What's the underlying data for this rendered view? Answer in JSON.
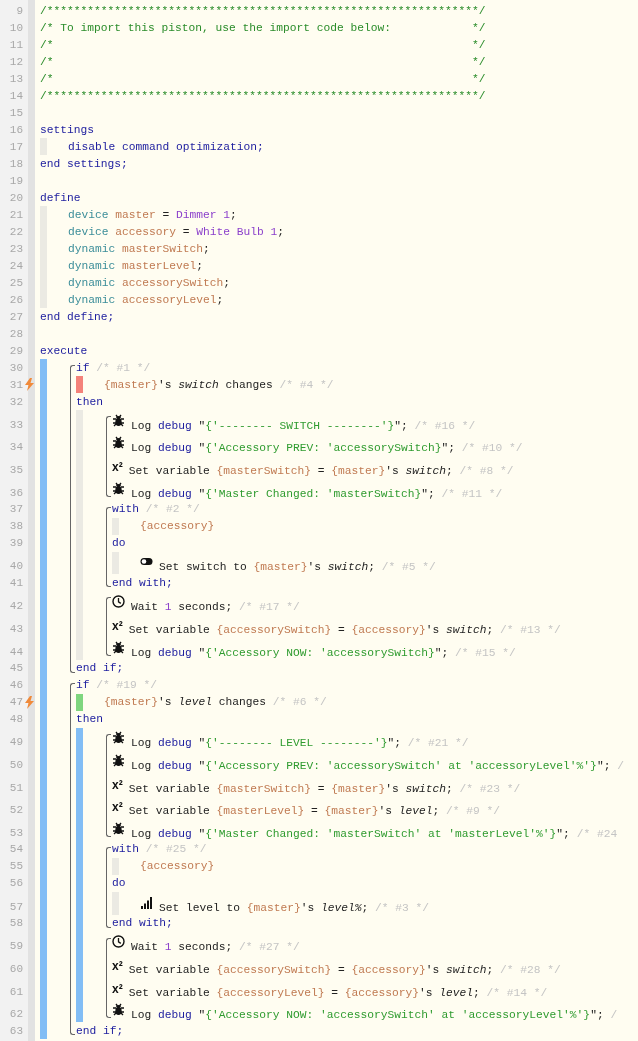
{
  "code": [
    {
      "kind": "line",
      "number": "9",
      "trigger": false,
      "tokens": [
        {
          "kind": "comment",
          "text": "/****************************************************************/"
        }
      ]
    },
    {
      "kind": "line",
      "number": "10",
      "trigger": false,
      "tokens": [
        {
          "kind": "comment",
          "text": "/* To import this piston, use the import code below:            */"
        }
      ]
    },
    {
      "kind": "line",
      "number": "11",
      "trigger": false,
      "tokens": [
        {
          "kind": "comment",
          "text": "/*                                                              */"
        }
      ]
    },
    {
      "kind": "line",
      "number": "12",
      "trigger": false,
      "tokens": [
        {
          "kind": "comment",
          "text": "/*                                                              */"
        }
      ]
    },
    {
      "kind": "line",
      "number": "13",
      "trigger": false,
      "tokens": [
        {
          "kind": "comment",
          "text": "/*                                                              */"
        }
      ]
    },
    {
      "kind": "line",
      "number": "14",
      "trigger": false,
      "tokens": [
        {
          "kind": "comment",
          "text": "/****************************************************************/"
        }
      ]
    },
    {
      "kind": "line",
      "number": "15",
      "trigger": false
    },
    {
      "kind": "line",
      "number": "16",
      "trigger": false,
      "tokens": [
        {
          "kind": "keyword",
          "text": "settings"
        }
      ]
    },
    {
      "kind": "block",
      "color": "#ebeae3",
      "items": [
        {
          "kind": "line",
          "number": "17",
          "trigger": false,
          "tokens": [
            {
              "kind": "keyword",
              "text": "disable command optimization;"
            }
          ]
        }
      ]
    },
    {
      "kind": "line",
      "number": "18",
      "trigger": false,
      "tokens": [
        {
          "kind": "keyword",
          "text": "end settings;"
        }
      ]
    },
    {
      "kind": "line",
      "number": "19",
      "trigger": false
    },
    {
      "kind": "line",
      "number": "20",
      "trigger": false,
      "tokens": [
        {
          "kind": "keyword",
          "text": "define"
        }
      ]
    },
    {
      "kind": "block",
      "color": "#ebeae3",
      "items": [
        {
          "kind": "line",
          "number": "21",
          "trigger": false,
          "tokens": [
            {
              "kind": "type",
              "text": "device "
            },
            {
              "kind": "var",
              "text": "master"
            },
            {
              "kind": "plain",
              "text": " = "
            },
            {
              "kind": "value",
              "text": "Dimmer 1"
            },
            {
              "kind": "plain",
              "text": ";"
            }
          ]
        },
        {
          "kind": "line",
          "number": "22",
          "trigger": false,
          "tokens": [
            {
              "kind": "type",
              "text": "device "
            },
            {
              "kind": "var",
              "text": "accessory"
            },
            {
              "kind": "plain",
              "text": " = "
            },
            {
              "kind": "value",
              "text": "White Bulb 1"
            },
            {
              "kind": "plain",
              "text": ";"
            }
          ]
        },
        {
          "kind": "line",
          "number": "23",
          "trigger": false,
          "tokens": [
            {
              "kind": "type",
              "text": "dynamic "
            },
            {
              "kind": "var",
              "text": "masterSwitch"
            },
            {
              "kind": "plain",
              "text": ";"
            }
          ]
        },
        {
          "kind": "line",
          "number": "24",
          "trigger": false,
          "tokens": [
            {
              "kind": "type",
              "text": "dynamic "
            },
            {
              "kind": "var",
              "text": "masterLevel"
            },
            {
              "kind": "plain",
              "text": ";"
            }
          ]
        },
        {
          "kind": "line",
          "number": "25",
          "trigger": false,
          "tokens": [
            {
              "kind": "type",
              "text": "dynamic "
            },
            {
              "kind": "var",
              "text": "accessorySwitch"
            },
            {
              "kind": "plain",
              "text": ";"
            }
          ]
        },
        {
          "kind": "line",
          "number": "26",
          "trigger": false,
          "tokens": [
            {
              "kind": "type",
              "text": "dynamic "
            },
            {
              "kind": "var",
              "text": "accessoryLevel"
            },
            {
              "kind": "plain",
              "text": ";"
            }
          ]
        }
      ]
    },
    {
      "kind": "line",
      "number": "27",
      "trigger": false,
      "tokens": [
        {
          "kind": "keyword",
          "text": "end define;"
        }
      ]
    },
    {
      "kind": "line",
      "number": "28",
      "trigger": false
    },
    {
      "kind": "line",
      "number": "29",
      "trigger": false,
      "tokens": [
        {
          "kind": "keyword",
          "text": "execute"
        }
      ]
    },
    {
      "kind": "block",
      "color": "#82bdf5",
      "items": [
        {
          "kind": "bracket",
          "items": [
            {
              "kind": "line",
              "number": "30",
              "trigger": false,
              "tokens": [
                {
                  "kind": "keyword",
                  "text": "if "
                },
                {
                  "kind": "note",
                  "text": "/* #1 */"
                }
              ]
            },
            {
              "kind": "block",
              "color": "#f4827a",
              "items": [
                {
                  "kind": "line",
                  "number": "31",
                  "trigger": true,
                  "tokens": [
                    {
                      "kind": "var",
                      "text": "{master}"
                    },
                    {
                      "kind": "plain",
                      "text": "'s "
                    },
                    {
                      "kind": "italic",
                      "text": "switch"
                    },
                    {
                      "kind": "plain",
                      "text": " changes "
                    },
                    {
                      "kind": "note",
                      "text": "/* #4 */"
                    }
                  ]
                }
              ]
            },
            {
              "kind": "line",
              "number": "32",
              "trigger": false,
              "tokens": [
                {
                  "kind": "keyword",
                  "text": "then"
                }
              ]
            },
            {
              "kind": "block",
              "color": "#ebeae3",
              "items": [
                {
                  "kind": "bracket",
                  "items": [
                    {
                      "kind": "log",
                      "number": "33",
                      "trigger": false,
                      "tokens": [
                        {
                          "kind": "plain",
                          "text": "Log "
                        },
                        {
                          "kind": "keyword",
                          "text": "debug "
                        },
                        {
                          "kind": "plain",
                          "text": "\""
                        },
                        {
                          "kind": "string",
                          "text": "{'-------- SWITCH --------'}"
                        },
                        {
                          "kind": "plain",
                          "text": "\"; "
                        },
                        {
                          "kind": "note",
                          "text": "/* #16 */"
                        }
                      ]
                    },
                    {
                      "kind": "log",
                      "number": "34",
                      "trigger": false,
                      "tokens": [
                        {
                          "kind": "plain",
                          "text": "Log "
                        },
                        {
                          "kind": "keyword",
                          "text": "debug "
                        },
                        {
                          "kind": "plain",
                          "text": "\""
                        },
                        {
                          "kind": "string",
                          "text": "{'Accessory PREV: 'accessorySwitch}"
                        },
                        {
                          "kind": "plain",
                          "text": "\"; "
                        },
                        {
                          "kind": "note",
                          "text": "/* #10 */"
                        }
                      ]
                    },
                    {
                      "kind": "set",
                      "number": "35",
                      "trigger": false,
                      "glyph": "x²",
                      "tokens": [
                        {
                          "kind": "plain",
                          "text": "Set variable "
                        },
                        {
                          "kind": "var",
                          "text": "{masterSwitch}"
                        },
                        {
                          "kind": "plain",
                          "text": " = "
                        },
                        {
                          "kind": "var",
                          "text": "{master}"
                        },
                        {
                          "kind": "plain",
                          "text": "'s "
                        },
                        {
                          "kind": "italic",
                          "text": "switch"
                        },
                        {
                          "kind": "plain",
                          "text": "; "
                        },
                        {
                          "kind": "note",
                          "text": "/* #8 */"
                        }
                      ]
                    },
                    {
                      "kind": "log",
                      "number": "36",
                      "trigger": false,
                      "tokens": [
                        {
                          "kind": "plain",
                          "text": "Log "
                        },
                        {
                          "kind": "keyword",
                          "text": "debug "
                        },
                        {
                          "kind": "plain",
                          "text": "\""
                        },
                        {
                          "kind": "string",
                          "text": "{'Master Changed: 'masterSwitch}"
                        },
                        {
                          "kind": "plain",
                          "text": "\"; "
                        },
                        {
                          "kind": "note",
                          "text": "/* #11 */"
                        }
                      ]
                    }
                  ]
                },
                {
                  "kind": "bracket",
                  "items": [
                    {
                      "kind": "line",
                      "number": "37",
                      "trigger": false,
                      "tokens": [
                        {
                          "kind": "keyword",
                          "text": "with "
                        },
                        {
                          "kind": "note",
                          "text": "/* #2 */"
                        }
                      ]
                    },
                    {
                      "kind": "block",
                      "color": "#ebeae3",
                      "items": [
                        {
                          "kind": "line",
                          "number": "38",
                          "trigger": false,
                          "tokens": [
                            {
                              "kind": "var",
                              "text": "{accessory}"
                            }
                          ]
                        }
                      ]
                    },
                    {
                      "kind": "line",
                      "number": "39",
                      "trigger": false,
                      "tokens": [
                        {
                          "kind": "keyword",
                          "text": "do"
                        }
                      ]
                    },
                    {
                      "kind": "block",
                      "color": "#ebeae3",
                      "items": [
                        {
                          "kind": "switch",
                          "number": "40",
                          "trigger": false,
                          "tokens": [
                            {
                              "kind": "plain",
                              "text": "Set switch to "
                            },
                            {
                              "kind": "var",
                              "text": "{master}"
                            },
                            {
                              "kind": "plain",
                              "text": "'s "
                            },
                            {
                              "kind": "italic",
                              "text": "switch"
                            },
                            {
                              "kind": "plain",
                              "text": "; "
                            },
                            {
                              "kind": "note",
                              "text": "/* #5 */"
                            }
                          ]
                        }
                      ]
                    },
                    {
                      "kind": "line",
                      "number": "41",
                      "trigger": false,
                      "tokens": [
                        {
                          "kind": "keyword",
                          "text": "end with;"
                        }
                      ]
                    }
                  ]
                },
                {
                  "kind": "bracket",
                  "items": [
                    {
                      "kind": "wait",
                      "number": "42",
                      "trigger": false,
                      "tokens": [
                        {
                          "kind": "plain",
                          "text": "Wait "
                        },
                        {
                          "kind": "value",
                          "text": "1"
                        },
                        {
                          "kind": "plain",
                          "text": " seconds; "
                        },
                        {
                          "kind": "note",
                          "text": "/* #17 */"
                        }
                      ]
                    },
                    {
                      "kind": "set",
                      "number": "43",
                      "trigger": false,
                      "glyph": "x²",
                      "tokens": [
                        {
                          "kind": "plain",
                          "text": "Set variable "
                        },
                        {
                          "kind": "var",
                          "text": "{accessorySwitch}"
                        },
                        {
                          "kind": "plain",
                          "text": " = "
                        },
                        {
                          "kind": "var",
                          "text": "{accessory}"
                        },
                        {
                          "kind": "plain",
                          "text": "'s "
                        },
                        {
                          "kind": "italic",
                          "text": "switch"
                        },
                        {
                          "kind": "plain",
                          "text": "; "
                        },
                        {
                          "kind": "note",
                          "text": "/* #13 */"
                        }
                      ]
                    },
                    {
                      "kind": "log",
                      "number": "44",
                      "trigger": false,
                      "tokens": [
                        {
                          "kind": "plain",
                          "text": "Log "
                        },
                        {
                          "kind": "keyword",
                          "text": "debug "
                        },
                        {
                          "kind": "plain",
                          "text": "\""
                        },
                        {
                          "kind": "string",
                          "text": "{'Accessory NOW: 'accessorySwitch}"
                        },
                        {
                          "kind": "plain",
                          "text": "\"; "
                        },
                        {
                          "kind": "note",
                          "text": "/* #15 */"
                        }
                      ]
                    }
                  ]
                }
              ]
            },
            {
              "kind": "line",
              "number": "45",
              "trigger": false,
              "tokens": [
                {
                  "kind": "keyword",
                  "text": "end if;"
                }
              ]
            }
          ]
        },
        {
          "kind": "bracket",
          "items": [
            {
              "kind": "line",
              "number": "46",
              "trigger": false,
              "tokens": [
                {
                  "kind": "keyword",
                  "text": "if "
                },
                {
                  "kind": "note",
                  "text": "/* #19 */"
                }
              ]
            },
            {
              "kind": "block",
              "color": "#7fd67f",
              "items": [
                {
                  "kind": "line",
                  "number": "47",
                  "trigger": true,
                  "tokens": [
                    {
                      "kind": "var",
                      "text": "{master}"
                    },
                    {
                      "kind": "plain",
                      "text": "'s "
                    },
                    {
                      "kind": "italic",
                      "text": "level"
                    },
                    {
                      "kind": "plain",
                      "text": " changes "
                    },
                    {
                      "kind": "note",
                      "text": "/* #6 */"
                    }
                  ]
                }
              ]
            },
            {
              "kind": "line",
              "number": "48",
              "trigger": false,
              "tokens": [
                {
                  "kind": "keyword",
                  "text": "then"
                }
              ]
            },
            {
              "kind": "block",
              "color": "#82bdf5",
              "items": [
                {
                  "kind": "bracket",
                  "items": [
                    {
                      "kind": "log",
                      "number": "49",
                      "trigger": false,
                      "tokens": [
                        {
                          "kind": "plain",
                          "text": "Log "
                        },
                        {
                          "kind": "keyword",
                          "text": "debug "
                        },
                        {
                          "kind": "plain",
                          "text": "\""
                        },
                        {
                          "kind": "string",
                          "text": "{'-------- LEVEL --------'}"
                        },
                        {
                          "kind": "plain",
                          "text": "\"; "
                        },
                        {
                          "kind": "note",
                          "text": "/* #21 */"
                        }
                      ]
                    },
                    {
                      "kind": "log",
                      "number": "50",
                      "trigger": false,
                      "tokens": [
                        {
                          "kind": "plain",
                          "text": "Log "
                        },
                        {
                          "kind": "keyword",
                          "text": "debug "
                        },
                        {
                          "kind": "plain",
                          "text": "\""
                        },
                        {
                          "kind": "string",
                          "text": "{'Accessory PREV: 'accessorySwitch' at 'accessoryLevel'%'}"
                        },
                        {
                          "kind": "plain",
                          "text": "\"; "
                        },
                        {
                          "kind": "note",
                          "text": "/"
                        }
                      ]
                    },
                    {
                      "kind": "set",
                      "number": "51",
                      "trigger": false,
                      "glyph": "x²",
                      "tokens": [
                        {
                          "kind": "plain",
                          "text": "Set variable "
                        },
                        {
                          "kind": "var",
                          "text": "{masterSwitch}"
                        },
                        {
                          "kind": "plain",
                          "text": " = "
                        },
                        {
                          "kind": "var",
                          "text": "{master}"
                        },
                        {
                          "kind": "plain",
                          "text": "'s "
                        },
                        {
                          "kind": "italic",
                          "text": "switch"
                        },
                        {
                          "kind": "plain",
                          "text": "; "
                        },
                        {
                          "kind": "note",
                          "text": "/* #23 */"
                        }
                      ]
                    },
                    {
                      "kind": "set",
                      "number": "52",
                      "trigger": false,
                      "glyph": "x²",
                      "tokens": [
                        {
                          "kind": "plain",
                          "text": "Set variable "
                        },
                        {
                          "kind": "var",
                          "text": "{masterLevel}"
                        },
                        {
                          "kind": "plain",
                          "text": " = "
                        },
                        {
                          "kind": "var",
                          "text": "{master}"
                        },
                        {
                          "kind": "plain",
                          "text": "'s "
                        },
                        {
                          "kind": "italic",
                          "text": "level"
                        },
                        {
                          "kind": "plain",
                          "text": "; "
                        },
                        {
                          "kind": "note",
                          "text": "/* #9 */"
                        }
                      ]
                    },
                    {
                      "kind": "log",
                      "number": "53",
                      "trigger": false,
                      "tokens": [
                        {
                          "kind": "plain",
                          "text": "Log "
                        },
                        {
                          "kind": "keyword",
                          "text": "debug "
                        },
                        {
                          "kind": "plain",
                          "text": "\""
                        },
                        {
                          "kind": "string",
                          "text": "{'Master Changed: 'masterSwitch' at 'masterLevel'%'}"
                        },
                        {
                          "kind": "plain",
                          "text": "\"; "
                        },
                        {
                          "kind": "note",
                          "text": "/* #24"
                        }
                      ]
                    }
                  ]
                },
                {
                  "kind": "bracket",
                  "items": [
                    {
                      "kind": "line",
                      "number": "54",
                      "trigger": false,
                      "tokens": [
                        {
                          "kind": "keyword",
                          "text": "with "
                        },
                        {
                          "kind": "note",
                          "text": "/* #25 */"
                        }
                      ]
                    },
                    {
                      "kind": "block",
                      "color": "#ebeae3",
                      "items": [
                        {
                          "kind": "line",
                          "number": "55",
                          "trigger": false,
                          "tokens": [
                            {
                              "kind": "var",
                              "text": "{accessory}"
                            }
                          ]
                        }
                      ]
                    },
                    {
                      "kind": "line",
                      "number": "56",
                      "trigger": false,
                      "tokens": [
                        {
                          "kind": "keyword",
                          "text": "do"
                        }
                      ]
                    },
                    {
                      "kind": "block",
                      "color": "#ebeae3",
                      "items": [
                        {
                          "kind": "level",
                          "number": "57",
                          "trigger": false,
                          "tokens": [
                            {
                              "kind": "plain",
                              "text": "Set level to "
                            },
                            {
                              "kind": "var",
                              "text": "{master}"
                            },
                            {
                              "kind": "plain",
                              "text": "'s "
                            },
                            {
                              "kind": "italic",
                              "text": "level%"
                            },
                            {
                              "kind": "plain",
                              "text": "; "
                            },
                            {
                              "kind": "note",
                              "text": "/* #3 */"
                            }
                          ]
                        }
                      ]
                    },
                    {
                      "kind": "line",
                      "number": "58",
                      "trigger": false,
                      "tokens": [
                        {
                          "kind": "keyword",
                          "text": "end with;"
                        }
                      ]
                    }
                  ]
                },
                {
                  "kind": "bracket",
                  "items": [
                    {
                      "kind": "wait",
                      "number": "59",
                      "trigger": false,
                      "tokens": [
                        {
                          "kind": "plain",
                          "text": "Wait "
                        },
                        {
                          "kind": "value",
                          "text": "1"
                        },
                        {
                          "kind": "plain",
                          "text": " seconds; "
                        },
                        {
                          "kind": "note",
                          "text": "/* #27 */"
                        }
                      ]
                    },
                    {
                      "kind": "set",
                      "number": "60",
                      "trigger": false,
                      "glyph": "x²",
                      "tokens": [
                        {
                          "kind": "plain",
                          "text": "Set variable "
                        },
                        {
                          "kind": "var",
                          "text": "{accessorySwitch}"
                        },
                        {
                          "kind": "plain",
                          "text": " = "
                        },
                        {
                          "kind": "var",
                          "text": "{accessory}"
                        },
                        {
                          "kind": "plain",
                          "text": "'s "
                        },
                        {
                          "kind": "italic",
                          "text": "switch"
                        },
                        {
                          "kind": "plain",
                          "text": "; "
                        },
                        {
                          "kind": "note",
                          "text": "/* #28 */"
                        }
                      ]
                    },
                    {
                      "kind": "set",
                      "number": "61",
                      "trigger": false,
                      "glyph": "x²",
                      "tokens": [
                        {
                          "kind": "plain",
                          "text": "Set variable "
                        },
                        {
                          "kind": "var",
                          "text": "{accessoryLevel}"
                        },
                        {
                          "kind": "plain",
                          "text": " = "
                        },
                        {
                          "kind": "var",
                          "text": "{accessory}"
                        },
                        {
                          "kind": "plain",
                          "text": "'s "
                        },
                        {
                          "kind": "italic",
                          "text": "level"
                        },
                        {
                          "kind": "plain",
                          "text": "; "
                        },
                        {
                          "kind": "note",
                          "text": "/* #14 */"
                        }
                      ]
                    },
                    {
                      "kind": "log",
                      "number": "62",
                      "trigger": false,
                      "tokens": [
                        {
                          "kind": "plain",
                          "text": "Log "
                        },
                        {
                          "kind": "keyword",
                          "text": "debug "
                        },
                        {
                          "kind": "plain",
                          "text": "\""
                        },
                        {
                          "kind": "string",
                          "text": "{'Accessory NOW: 'accessorySwitch' at 'accessoryLevel'%'}"
                        },
                        {
                          "kind": "plain",
                          "text": "\"; "
                        },
                        {
                          "kind": "note",
                          "text": "/"
                        }
                      ]
                    }
                  ]
                }
              ]
            },
            {
              "kind": "line",
              "number": "63",
              "trigger": false,
              "tokens": [
                {
                  "kind": "keyword",
                  "text": "end if;"
                }
              ]
            }
          ]
        }
      ]
    }
  ]
}
